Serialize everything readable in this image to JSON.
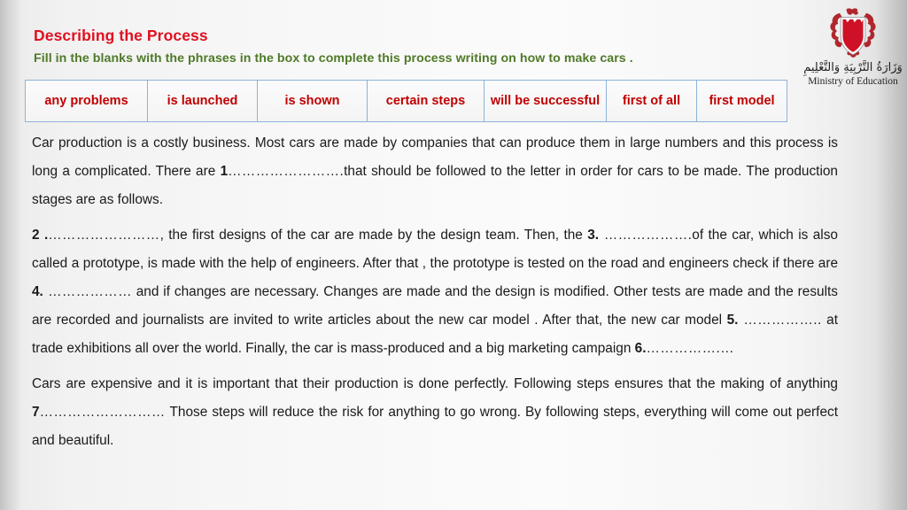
{
  "slide": {
    "title": "Describing the Process",
    "subtitle": "Fill in the blanks  with the phrases in the box to complete this process writing on how to make cars .",
    "title_color": "#e01020",
    "subtitle_color": "#4f7a28",
    "phrase_color": "#c00000",
    "table_border_color": "#8db3d9"
  },
  "logo": {
    "arabic": "وَزَارَةُ التَّرْبِيَةِ وَالتَّعْلِيمِ",
    "english": "Ministry of Education"
  },
  "phrase_box": {
    "cells": [
      "any problems",
      "is launched",
      "is shown",
      "certain steps",
      "will be successful",
      "first of all",
      "first model"
    ]
  },
  "paragraphs": [
    {
      "id": "paragraph-1",
      "runs": [
        {
          "text": "Car production is a costly business. Most cars are made by companies that can produce them in large numbers and this process is long a complicated. There are ",
          "style": "normal"
        },
        {
          "text": "1",
          "style": "bold"
        },
        {
          "text": "…………………….",
          "style": "dots"
        },
        {
          "text": "that should be followed to the letter in order for cars to be made. The production stages are as follows.",
          "style": "normal"
        }
      ]
    },
    {
      "id": "paragraph-2",
      "runs": [
        {
          "text": "2 .",
          "style": "bold"
        },
        {
          "text": "……………………",
          "style": "dots"
        },
        {
          "text": ", the first designs of the car are made by the design team. Then, the ",
          "style": "normal"
        },
        {
          "text": "3.",
          "style": "bold"
        },
        {
          "text": " ……………….",
          "style": "dots"
        },
        {
          "text": "of the car, which is also called a prototype, is made with the help of engineers. After that , the prototype is tested on the road and engineers check if there are ",
          "style": "normal"
        },
        {
          "text": "4.",
          "style": "bold"
        },
        {
          "text": " ………………",
          "style": "dots"
        },
        {
          "text": " and if changes are necessary. Changes are made and the design is modified. Other tests are made and the results are recorded and journalists are invited to write articles about the new car model . After that, the new car model ",
          "style": "normal"
        },
        {
          "text": "5.",
          "style": "bold"
        },
        {
          "text": "  ……………..",
          "style": "dots"
        },
        {
          "text": " at trade exhibitions all over the world. Finally, the car is mass-produced and a big marketing campaign ",
          "style": "normal"
        },
        {
          "text": "6.",
          "style": "bold"
        },
        {
          "text": "…………….…",
          "style": "dots"
        }
      ]
    },
    {
      "id": "paragraph-3",
      "runs": [
        {
          "text": "Cars are expensive and it is important that their production is done perfectly. Following steps ensures that the making of anything ",
          "style": "normal"
        },
        {
          "text": "7",
          "style": "bold"
        },
        {
          "text": "………………………",
          "style": "dots"
        },
        {
          "text": " Those steps will reduce the risk for anything to go wrong. By following steps, everything will come out perfect and beautiful.",
          "style": "normal"
        }
      ]
    }
  ]
}
